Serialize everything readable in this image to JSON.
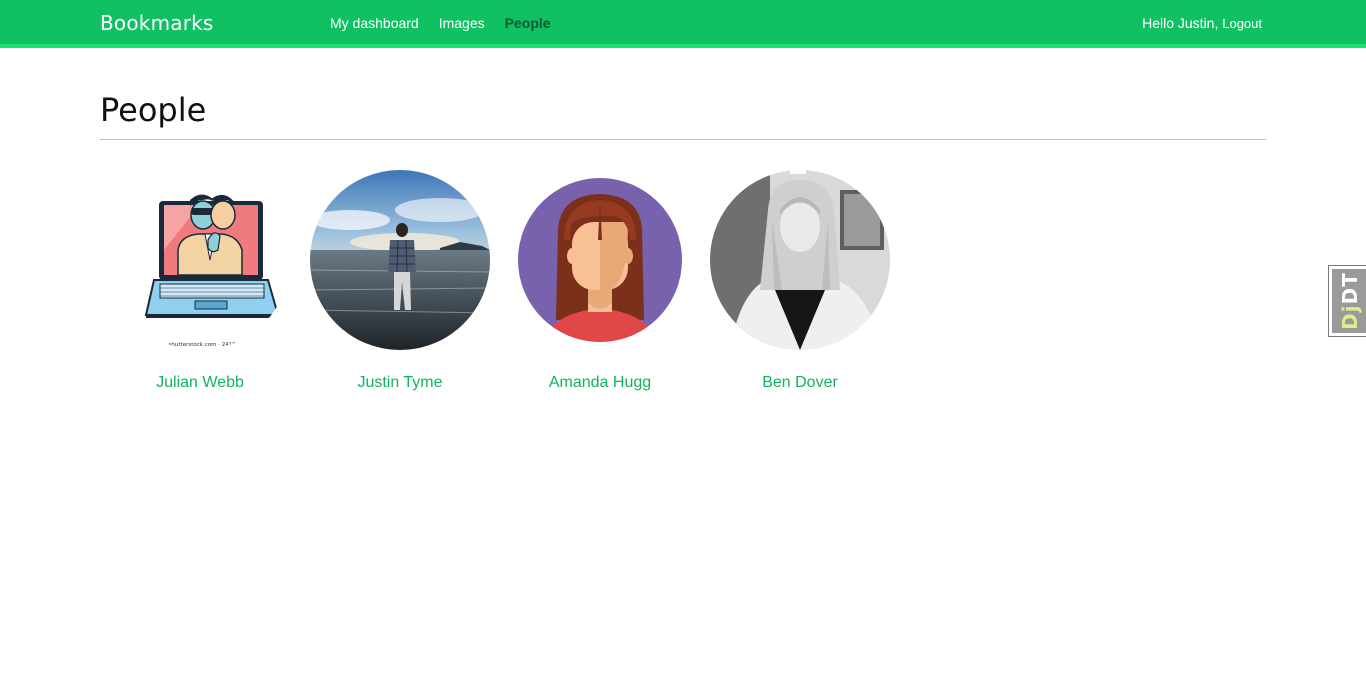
{
  "header": {
    "logo": "Bookmarks",
    "nav": [
      {
        "label": "My dashboard",
        "active": false
      },
      {
        "label": "Images",
        "active": false
      },
      {
        "label": "People",
        "active": true
      }
    ],
    "greeting": "Hello Justin,",
    "logout": "Logout"
  },
  "main": {
    "title": "People",
    "people": [
      {
        "name": "Julian Webb",
        "avatar": "laptop-masked-man-illustration",
        "watermark": "shutterstock.com · 2410834..."
      },
      {
        "name": "Justin Tyme",
        "avatar": "person-standing-on-beach-photo"
      },
      {
        "name": "Amanda Hugg",
        "avatar": "woman-avatar-illustration"
      },
      {
        "name": "Ben Dover",
        "avatar": "black-white-girl-portrait-photo"
      }
    ]
  },
  "toolbar_tab": {
    "prefix": "Dj",
    "suffix": "DT"
  },
  "colors": {
    "brand": "#12c064",
    "link": "#12b35e",
    "active_nav": "#0f5a31"
  }
}
